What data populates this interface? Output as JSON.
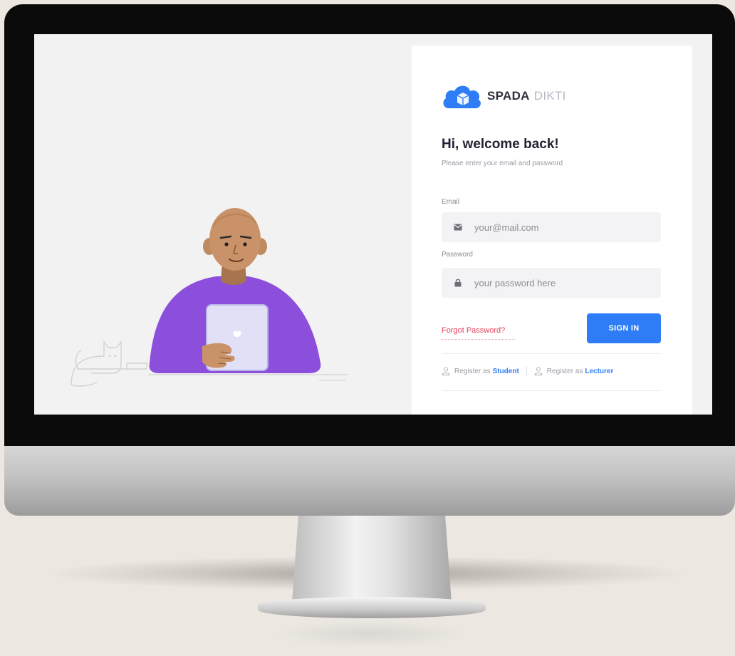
{
  "brand": {
    "name": "SPADA",
    "suffix": "DIKTI",
    "logo_icon": "cloud-cube-icon",
    "color": "#2f7df6"
  },
  "login": {
    "heading": "Hi, welcome back!",
    "subheading": "Please enter your email and password",
    "email": {
      "label": "Email",
      "placeholder": "your@mail.com",
      "icon": "mail-icon"
    },
    "password": {
      "label": "Password",
      "placeholder": "your password here",
      "icon": "lock-icon"
    },
    "forgot_label": "Forgot Password?",
    "signin_label": "SIGN IN",
    "register": [
      {
        "prefix": "Register as",
        "link": "Student",
        "icon": "user-icon"
      },
      {
        "prefix": "Register as",
        "link": "Lecturer",
        "icon": "user-icon"
      }
    ]
  },
  "colors": {
    "accent": "#2f7df6",
    "danger": "#e0455c",
    "shirt": "#8b4fdc",
    "skin": "#c99268"
  }
}
